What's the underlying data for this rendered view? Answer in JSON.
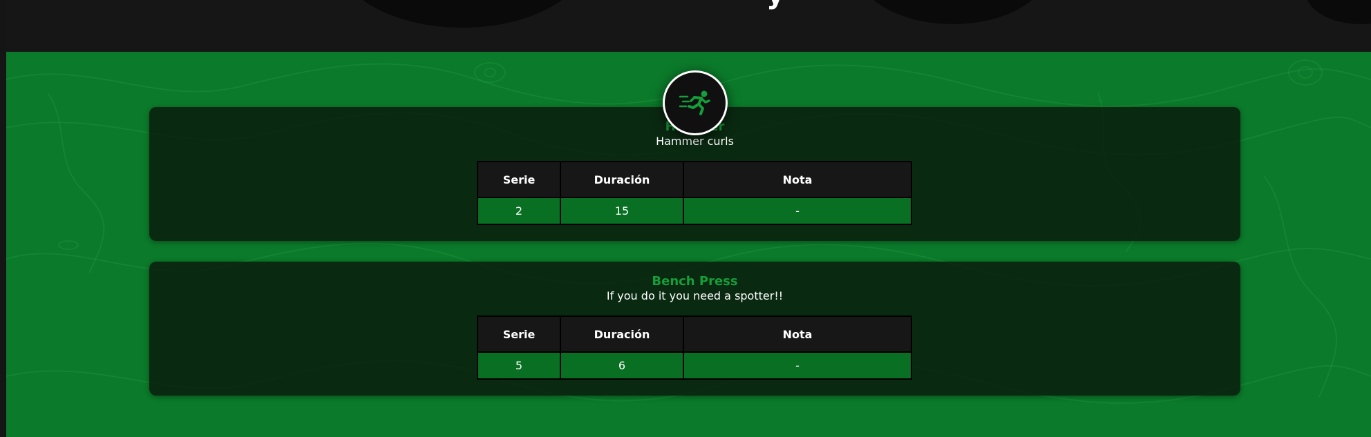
{
  "hero": {
    "title_fragment": "y"
  },
  "badge": {
    "icon": "running-person-icon",
    "color": "#159e3a"
  },
  "colors": {
    "main_green": "#0b7a2a",
    "accent_green": "#159e3a",
    "row_green": "#086f23",
    "header_dark": "#171717"
  },
  "exercises": [
    {
      "name": "Hammer",
      "description": "Hammer curls",
      "columns": [
        "Serie",
        "Duración",
        "Nota"
      ],
      "row": {
        "serie": "2",
        "duracion": "15",
        "nota": "-"
      }
    },
    {
      "name": "Bench Press",
      "description": "If you do it you need a spotter!!",
      "columns": [
        "Serie",
        "Duración",
        "Nota"
      ],
      "row": {
        "serie": "5",
        "duracion": "6",
        "nota": "-"
      }
    }
  ]
}
